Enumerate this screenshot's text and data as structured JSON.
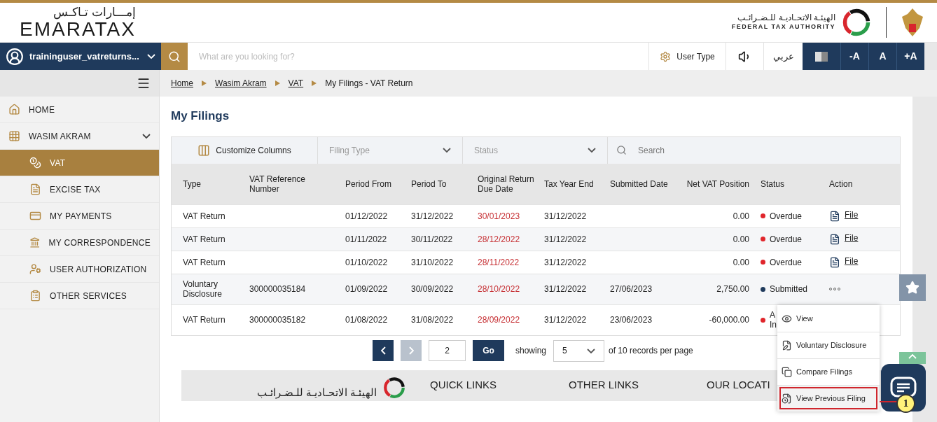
{
  "header": {
    "logo_arabic": "إمـــارات تـاكـس",
    "logo": "EMARATAX",
    "fta_arabic": "الهيئـة الاتحـاديـة للـضـرائـب",
    "fta_english": "FEDERAL TAX AUTHORITY"
  },
  "topbar": {
    "user": "traininguser_vatreturns...",
    "search_placeholder": "What are you looking for?",
    "user_type": "User Type",
    "language": "عربي",
    "font_buttons": [
      "-A",
      "A",
      "+A"
    ]
  },
  "breadcrumb": [
    "Home",
    "Wasim Akram",
    "VAT",
    "My Filings - VAT Return"
  ],
  "sidebar": {
    "items": [
      {
        "label": "HOME",
        "selected": false
      },
      {
        "label": "WASIM AKRAM",
        "selected": false,
        "expanded": true
      },
      {
        "label": "VAT",
        "selected": true
      },
      {
        "label": "EXCISE TAX",
        "selected": false
      },
      {
        "label": "MY PAYMENTS",
        "selected": false
      },
      {
        "label": "MY CORRESPONDENCE",
        "selected": false
      },
      {
        "label": "USER AUTHORIZATION",
        "selected": false
      },
      {
        "label": "OTHER SERVICES",
        "selected": false
      }
    ]
  },
  "page_title": "My Filings",
  "toolbar": {
    "customize": "Customize Columns",
    "filters": [
      "Filing Type",
      "Status"
    ],
    "search_placeholder": "Search"
  },
  "table": {
    "columns": [
      "Type",
      "VAT Reference Number",
      "Period From",
      "Period To",
      "Original Return Due Date",
      "Tax Year End",
      "Submitted Date",
      "Net VAT Position",
      "Status",
      "Action"
    ],
    "rows": [
      {
        "type": "VAT Return",
        "ref": "",
        "from": "01/12/2022",
        "to": "31/12/2022",
        "due": "30/01/2023",
        "year_end": "31/12/2022",
        "submitted": "",
        "net": "0.00",
        "status": [
          "Overdue"
        ],
        "color": "#e0252b",
        "action": {
          "kind": "file",
          "label": "File"
        }
      },
      {
        "type": "VAT Return",
        "ref": "",
        "from": "01/11/2022",
        "to": "30/11/2022",
        "due": "28/12/2022",
        "year_end": "31/12/2022",
        "submitted": "",
        "net": "0.00",
        "status": [
          "Overdue"
        ],
        "color": "#e0252b",
        "action": {
          "kind": "file",
          "label": "File"
        }
      },
      {
        "type": "VAT Return",
        "ref": "",
        "from": "01/10/2022",
        "to": "31/10/2022",
        "due": "28/11/2022",
        "year_end": "31/12/2022",
        "submitted": "",
        "net": "0.00",
        "status": [
          "Overdue"
        ],
        "color": "#e0252b",
        "action": {
          "kind": "file",
          "label": "File"
        }
      },
      {
        "type": "Voluntary Disclosure",
        "ref": "300000035184",
        "from": "01/09/2022",
        "to": "30/09/2022",
        "due": "28/10/2022",
        "year_end": "31/12/2022",
        "submitted": "27/06/2023",
        "net": "2,750.00",
        "status": [
          "Submitted"
        ],
        "color": "#1f3a5c",
        "action": {
          "kind": "more"
        }
      },
      {
        "type": "VAT Return",
        "ref": "300000035182",
        "from": "01/08/2022",
        "to": "31/08/2022",
        "due": "28/09/2022",
        "year_end": "31/12/2022",
        "submitted": "23/06/2023",
        "net": "-60,000.00",
        "status": [
          "A",
          "In"
        ],
        "color": "#e0252b",
        "action": {
          "kind": "none"
        }
      }
    ]
  },
  "pagination": {
    "prev_disabled": false,
    "next_disabled": true,
    "page": "2",
    "go": "Go",
    "showing": "showing",
    "per_page": "5",
    "suffix": "of 10 records per page"
  },
  "action_menu": {
    "items": [
      {
        "label": "View",
        "highlighted": false
      },
      {
        "label": "Voluntary Disclosure",
        "highlighted": false
      },
      {
        "label": "Compare Filings",
        "highlighted": false
      },
      {
        "label": "View Previous Filing",
        "highlighted": true
      }
    ],
    "callout": "1"
  },
  "footer": {
    "arabic": "الهيئـة الاتحـاديـة للـضـرائـب",
    "headings": [
      "QUICK LINKS",
      "OTHER LINKS",
      "OUR LOCATI"
    ]
  }
}
